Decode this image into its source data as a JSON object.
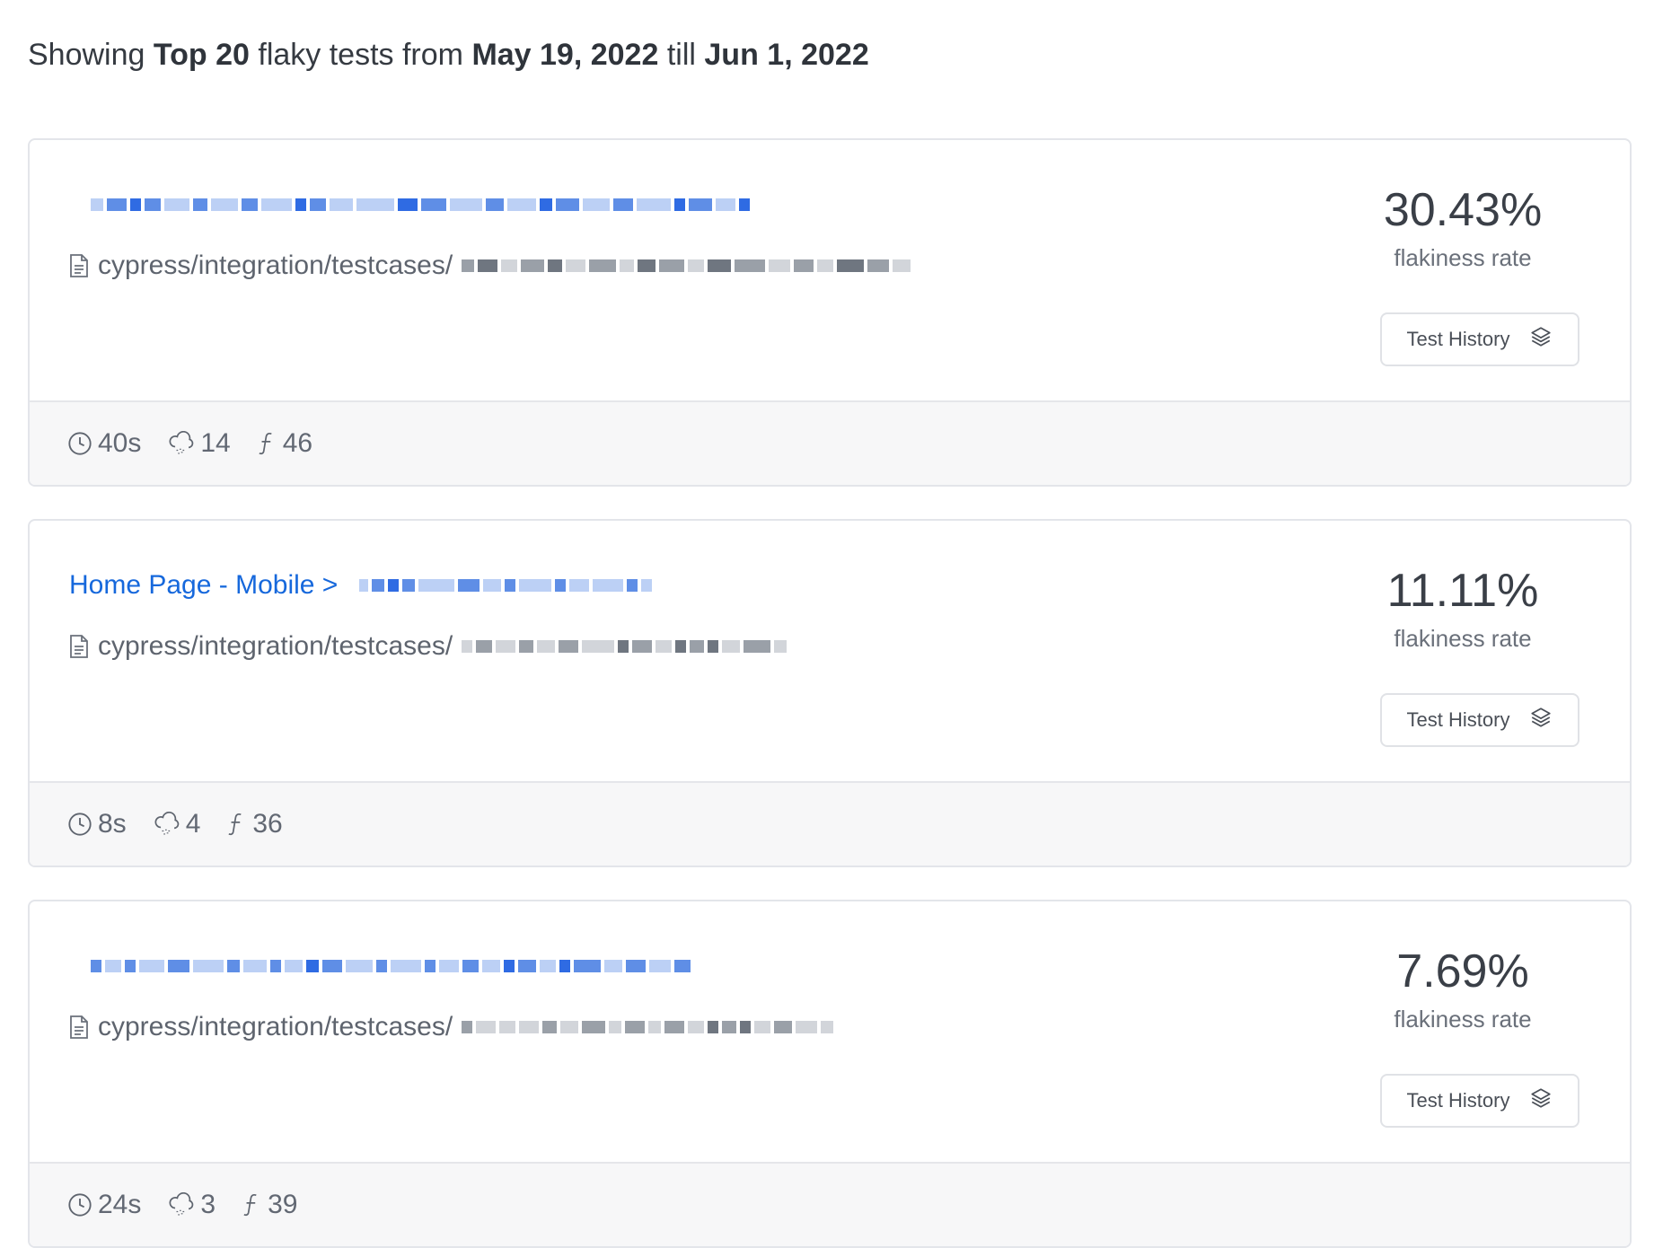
{
  "summary": {
    "prefix": "Showing",
    "count": "Top 20",
    "middle": "flaky tests from",
    "start": "May 19, 2022",
    "till": "till",
    "end": "Jun 1, 2022"
  },
  "button_label": "Test History",
  "rate_label": "flakiness rate",
  "cards": [
    {
      "title": "",
      "path": "cypress/integration/testcases/",
      "rate": "30.43%",
      "duration": "40s",
      "flaky_count": "14",
      "fn_count": "46"
    },
    {
      "title": "Home Page - Mobile >",
      "path": "cypress/integration/testcases/",
      "rate": "11.11%",
      "duration": "8s",
      "flaky_count": "4",
      "fn_count": "36"
    },
    {
      "title": "",
      "path": "cypress/integration/testcases/",
      "rate": "7.69%",
      "duration": "24s",
      "flaky_count": "3",
      "fn_count": "39"
    }
  ],
  "icons": {
    "path": "file-text-icon",
    "history": "layers-icon",
    "duration": "clock-icon",
    "flaky": "cloud-drizzle-icon",
    "functions": "function-icon"
  },
  "colors": {
    "link": "#1668dc",
    "footer_bg": "#f7f7f8",
    "border": "#e3e5ea"
  }
}
